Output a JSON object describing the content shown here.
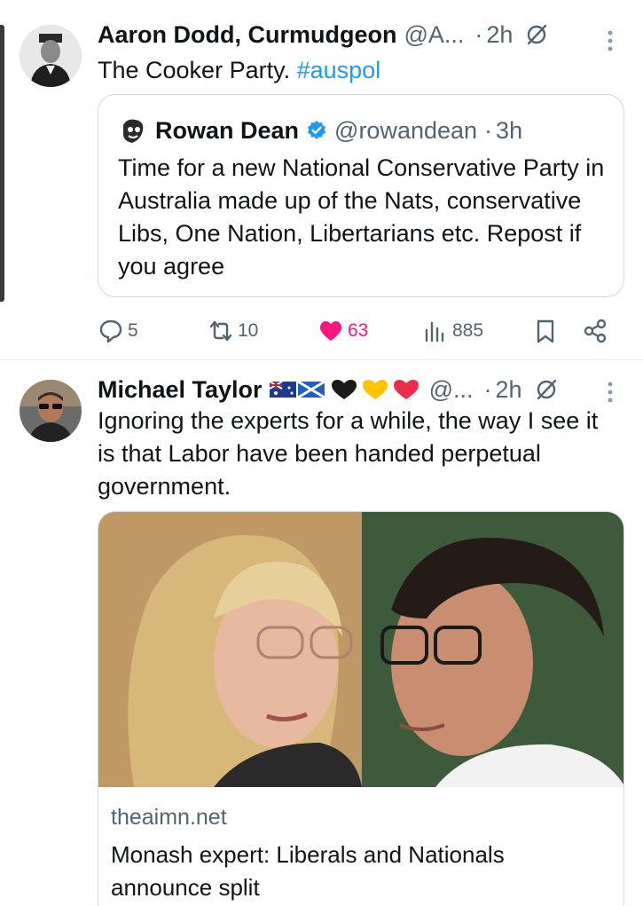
{
  "tweet1": {
    "name": "Aaron Dodd, Curmudgeon",
    "handle": "@A...",
    "dot": "·",
    "time": "2h",
    "text_plain": "The Cooker Party. ",
    "hashtag": "#auspol",
    "quote": {
      "name": "Rowan Dean",
      "handle": "@rowandean",
      "dot": "·",
      "time": "3h",
      "text": "Time for a new National Conservative Party in Australia made up of the Nats, conservative Libs, One Nation, Libertarians etc. Repost if you agree"
    },
    "actions": {
      "replies": "5",
      "reposts": "10",
      "likes": "63",
      "views": "885"
    }
  },
  "tweet2": {
    "name": "Michael Taylor",
    "handle": "@...",
    "dot": "·",
    "time": "2h",
    "text": "Ignoring the experts for a while, the way I see it is that Labor have been handed perpetual government.",
    "card": {
      "domain": "theaimn.net",
      "title": "Monash expert: Liberals and Nationals announce split"
    }
  },
  "colors": {
    "link": "#1d9bf0",
    "like": "#f91880",
    "muted": "#536471",
    "border": "#cfd9de",
    "verified": "#1d9bf0"
  },
  "icons": [
    "grok-icon",
    "more-icon",
    "verified-icon",
    "reply-icon",
    "repost-icon",
    "like-icon",
    "views-icon",
    "bookmark-icon",
    "share-icon"
  ]
}
